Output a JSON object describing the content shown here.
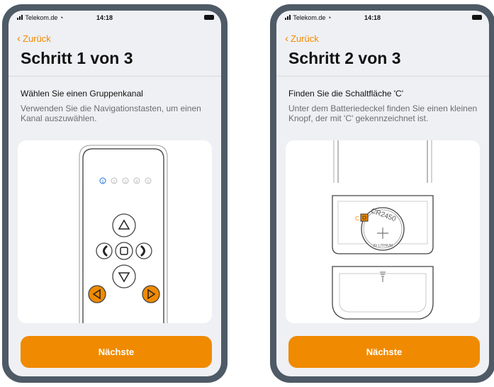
{
  "accent_color": "#f08a00",
  "screens": [
    {
      "status": {
        "carrier": "Telekom.de",
        "time": "14:18"
      },
      "back_label": "Zurück",
      "title": "Schritt 1 von 3",
      "heading": "Wählen Sie einen Gruppenkanal",
      "description": "Verwenden Sie die Navigationstasten, um einen Kanal auszuwählen.",
      "illustration": {
        "channels": [
          "1",
          "2",
          "3",
          "4",
          "5"
        ],
        "selected_channel": "1",
        "buttons": [
          "up-icon",
          "left-icon",
          "stop-icon",
          "right-icon",
          "down-icon",
          "prev-channel-icon",
          "next-channel-icon"
        ]
      },
      "next_label": "Nächste"
    },
    {
      "status": {
        "carrier": "Telekom.de",
        "time": "14:18"
      },
      "back_label": "Zurück",
      "title": "Schritt 2 von 3",
      "heading": "Finden Sie die Schaltfläche 'C'",
      "description": "Unter dem Batteriedeckel finden Sie einen kleinen Knopf, der mit 'C' gekennzeichnet ist.",
      "illustration": {
        "battery_label": "CR2450",
        "battery_small_text": "3V LITHIUM",
        "button_letter": "C"
      },
      "next_label": "Nächste"
    }
  ]
}
